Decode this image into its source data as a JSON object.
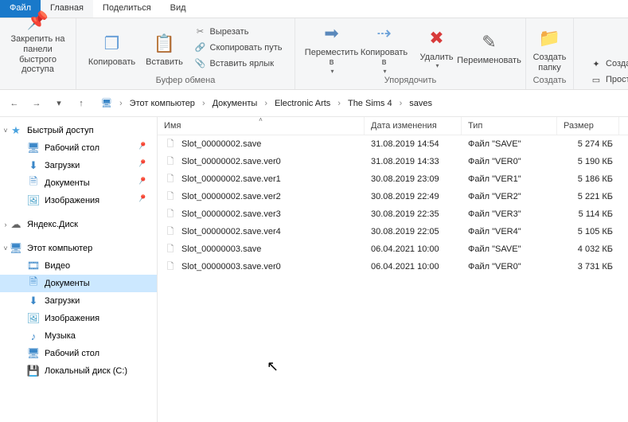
{
  "tabs": {
    "file": "Файл",
    "home": "Главная",
    "share": "Поделиться",
    "view": "Вид"
  },
  "ribbon": {
    "pin": "Закрепить на панели\nбыстрого доступа",
    "copy": "Копировать",
    "paste": "Вставить",
    "cut": "Вырезать",
    "copy_path": "Скопировать путь",
    "paste_shortcut": "Вставить ярлык",
    "clipboard_group": "Буфер обмена",
    "move_to": "Переместить в",
    "copy_to": "Копировать в",
    "delete": "Удалить",
    "rename": "Переименовать",
    "organize_group": "Упорядочить",
    "new_folder": "Создать папку",
    "create_group": "Создать",
    "new_item": "Создать",
    "easy_access": "Простой"
  },
  "nav": {
    "back": "←",
    "forward": "→",
    "up": "↑"
  },
  "breadcrumbs": [
    "Этот компьютер",
    "Документы",
    "Electronic Arts",
    "The Sims 4",
    "saves"
  ],
  "navpane": {
    "quick": "Быстрый доступ",
    "desktop": "Рабочий стол",
    "downloads": "Загрузки",
    "documents": "Документы",
    "images": "Изображения",
    "yandex": "Яндекс.Диск",
    "this_pc": "Этот компьютер",
    "video": "Видео",
    "documents2": "Документы",
    "downloads2": "Загрузки",
    "images2": "Изображения",
    "music": "Музыка",
    "desktop2": "Рабочий стол",
    "local_disk": "Локальный диск (C:)"
  },
  "columns": {
    "name": "Имя",
    "date": "Дата изменения",
    "type": "Тип",
    "size": "Размер"
  },
  "files": [
    {
      "name": "Slot_00000002.save",
      "date": "31.08.2019 14:54",
      "type": "Файл \"SAVE\"",
      "size": "5 274 КБ"
    },
    {
      "name": "Slot_00000002.save.ver0",
      "date": "31.08.2019 14:33",
      "type": "Файл \"VER0\"",
      "size": "5 190 КБ"
    },
    {
      "name": "Slot_00000002.save.ver1",
      "date": "30.08.2019 23:09",
      "type": "Файл \"VER1\"",
      "size": "5 186 КБ"
    },
    {
      "name": "Slot_00000002.save.ver2",
      "date": "30.08.2019 22:49",
      "type": "Файл \"VER2\"",
      "size": "5 221 КБ"
    },
    {
      "name": "Slot_00000002.save.ver3",
      "date": "30.08.2019 22:35",
      "type": "Файл \"VER3\"",
      "size": "5 114 КБ"
    },
    {
      "name": "Slot_00000002.save.ver4",
      "date": "30.08.2019 22:05",
      "type": "Файл \"VER4\"",
      "size": "5 105 КБ"
    },
    {
      "name": "Slot_00000003.save",
      "date": "06.04.2021 10:00",
      "type": "Файл \"SAVE\"",
      "size": "4 032 КБ"
    },
    {
      "name": "Slot_00000003.save.ver0",
      "date": "06.04.2021 10:00",
      "type": "Файл \"VER0\"",
      "size": "3 731 КБ"
    }
  ]
}
